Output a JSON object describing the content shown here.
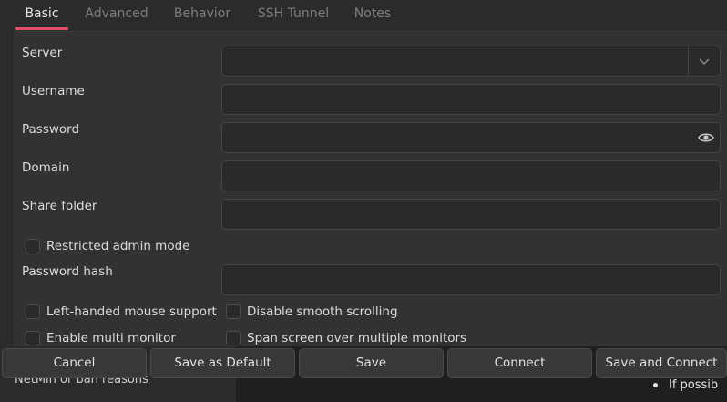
{
  "tabs": [
    {
      "label": "Basic",
      "active": true
    },
    {
      "label": "Advanced",
      "active": false
    },
    {
      "label": "Behavior",
      "active": false
    },
    {
      "label": "SSH Tunnel",
      "active": false
    },
    {
      "label": "Notes",
      "active": false
    }
  ],
  "form": {
    "server": {
      "label": "Server",
      "value": ""
    },
    "username": {
      "label": "Username",
      "value": ""
    },
    "password": {
      "label": "Password",
      "value": ""
    },
    "domain": {
      "label": "Domain",
      "value": ""
    },
    "share_folder": {
      "label": "Share folder",
      "value": ""
    },
    "restricted_admin": {
      "label": "Restricted admin mode",
      "checked": false
    },
    "password_hash": {
      "label": "Password hash",
      "value": ""
    },
    "left_handed": {
      "label": "Left-handed mouse support",
      "checked": false
    },
    "disable_smooth": {
      "label": "Disable smooth scrolling",
      "checked": false
    },
    "multi_monitor": {
      "label": "Enable multi monitor",
      "checked": false
    },
    "span_screen": {
      "label": "Span screen over multiple monitors",
      "checked": false
    }
  },
  "buttons": {
    "cancel": "Cancel",
    "save_default": "Save as Default",
    "save": "Save",
    "connect": "Connect",
    "save_connect": "Save and Connect"
  },
  "background": {
    "left_text": "NetMin or ban reasons",
    "right_text": "If possib"
  },
  "colors": {
    "accent": "#e0506a",
    "panel": "#323232",
    "field": "#2a2a2a"
  },
  "icons": {
    "dropdown": "chevron-down-icon",
    "reveal": "eye-icon"
  }
}
